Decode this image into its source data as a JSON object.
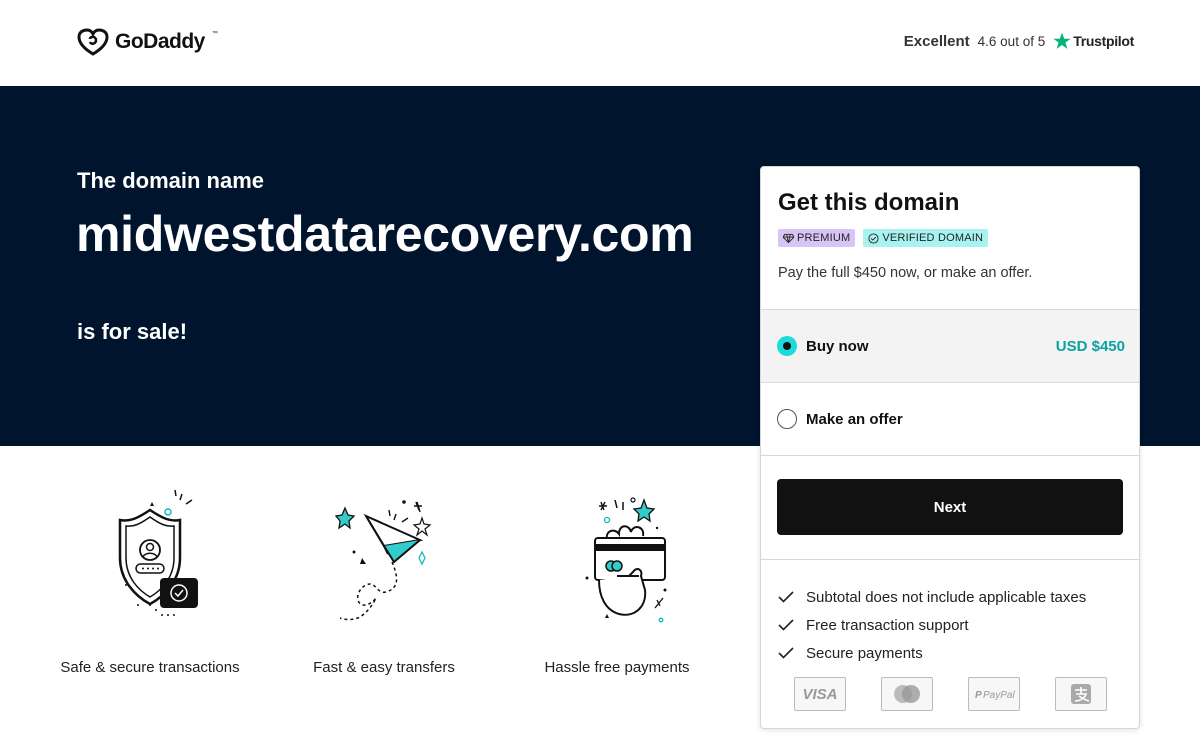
{
  "header": {
    "logo_text": "GoDaddy",
    "rating_label": "Excellent",
    "rating_score": "4.6 out of 5",
    "rating_provider": "Trustpilot"
  },
  "hero": {
    "pre_text": "The domain name",
    "domain": "midwestdatarecovery.com",
    "post_text": "is for sale!"
  },
  "features": [
    {
      "label": "Safe & secure transactions",
      "icon": "shield-icon"
    },
    {
      "label": "Fast & easy transfers",
      "icon": "paper-plane-icon"
    },
    {
      "label": "Hassle free payments",
      "icon": "hand-card-icon"
    }
  ],
  "card": {
    "title": "Get this domain",
    "badges": {
      "premium": "PREMIUM",
      "verified": "VERIFIED DOMAIN"
    },
    "subtitle": "Pay the full $450 now, or make an offer.",
    "options": {
      "buy_label": "Buy now",
      "buy_price": "USD $450",
      "offer_label": "Make an offer",
      "selected": "buy"
    },
    "next_label": "Next",
    "checks": [
      "Subtotal does not include applicable taxes",
      "Free transaction support",
      "Secure payments"
    ],
    "payment_logos": [
      "VISA",
      "mastercard",
      "PayPal",
      "alipay"
    ]
  },
  "colors": {
    "hero_bg": "#00142e",
    "accent_teal": "#1bdbdb",
    "price_teal": "#09a3a3",
    "trustpilot_green": "#00b67a",
    "premium_badge": "#d7c5f5",
    "verified_badge": "#a8f3f0",
    "button_bg": "#111111"
  }
}
